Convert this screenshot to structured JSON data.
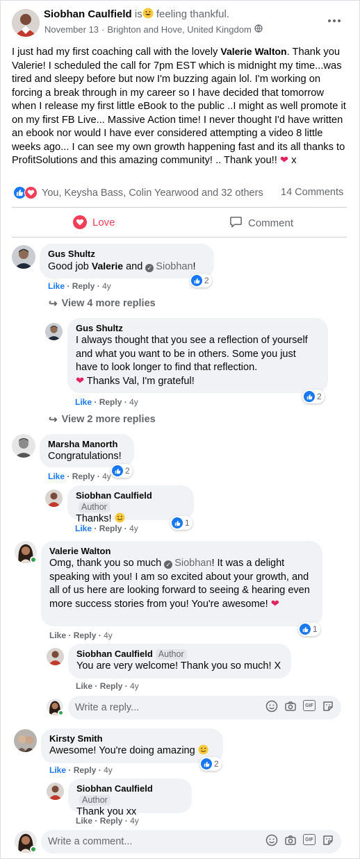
{
  "post": {
    "author": "Siobhan Caulfield",
    "is": "is",
    "feeling": "feeling thankful.",
    "date": "November 13",
    "sep": "·",
    "location": "Brighton and Hove, United Kingdom",
    "text_1": "I just had my first coaching call with the lovely ",
    "mention_valerie": "Valerie Walton",
    "text_2": ". Thank you Valerie! I scheduled the call for 7pm EST which is midnight my time...was tired and sleepy before but now I'm buzzing again lol. I'm working on forcing a break through in my career so I have decided that tomorrow when I release my first little eBook to the public ..I might as well promote it on my first FB Live... Massive Action time! I never thought I'd have written an ebook nor would I have ever considered attempting a video 8 little weeks ago... I can see my own growth happening fast and its all thanks to ProfitSolutions and this amazing community! .. Thank you!!",
    "text_end": " x",
    "reactions_text": "You, Keysha Bass, Colin Yearwood and 32 others",
    "comments_count": "14 Comments",
    "love_label": "Love",
    "comment_label": "Comment",
    "more_icon": "more-icon",
    "colors": {
      "accent": "#1877f2",
      "love": "#f33e58",
      "text": "#050505",
      "muted": "#65676b",
      "bubble": "#f0f2f5"
    }
  },
  "actions": {
    "like": "Like",
    "reply": "Reply",
    "dot": "·"
  },
  "comments": {
    "c1": {
      "name": "Gus Shultz",
      "text_a": "Good job ",
      "mention_a": "Valerie",
      "text_b": " and ",
      "mention_b": "Siobhan",
      "text_c": "!",
      "time": "4y",
      "reactions": "2",
      "more": "View 4 more replies"
    },
    "c1r1": {
      "name": "Gus Shultz",
      "text": "I always thought that you see a reflection of yourself and what you want to be in others. Some you just have to look longer to find that reflection.",
      "text_2": " Thanks Val, I'm grateful!",
      "time": "4y",
      "reactions": "2",
      "more": "View 2 more replies"
    },
    "c2": {
      "name": "Marsha Manorth",
      "text": "Congratulations!",
      "time": "4y",
      "reactions": "2"
    },
    "c2r1": {
      "name": "Siobhan Caulfield",
      "badge": "Author",
      "text": "Thanks!",
      "time": "4y",
      "reactions": "1"
    },
    "c3": {
      "name": "Valerie Walton",
      "text_a": "Omg, thank you so much ",
      "mention": "Siobhan",
      "text_b": "! It was a delight speaking with you! I am so excited about your growth, and all of us here are looking forward to seeing & hearing even more success stories from you! You're awesome!",
      "time": "4y",
      "reactions": "1"
    },
    "c3r1": {
      "name": "Siobhan Caulfield",
      "badge": "Author",
      "text": "You are very welcome! Thank you so much! X",
      "time": "4y"
    },
    "c3reply_placeholder": "Write a reply...",
    "c4": {
      "name": "Kirsty Smith",
      "text": "Awesome! You're doing amazing",
      "time": "4y",
      "reactions": "2"
    },
    "c4r1": {
      "name": "Siobhan Caulfield",
      "badge": "Author",
      "text": "Thank you xx",
      "time": "4y"
    },
    "comment_placeholder": "Write a comment..."
  },
  "input_icons": [
    "smiley-icon",
    "camera-icon",
    "gif-icon",
    "sticker-icon"
  ],
  "gif_label": "GIF"
}
